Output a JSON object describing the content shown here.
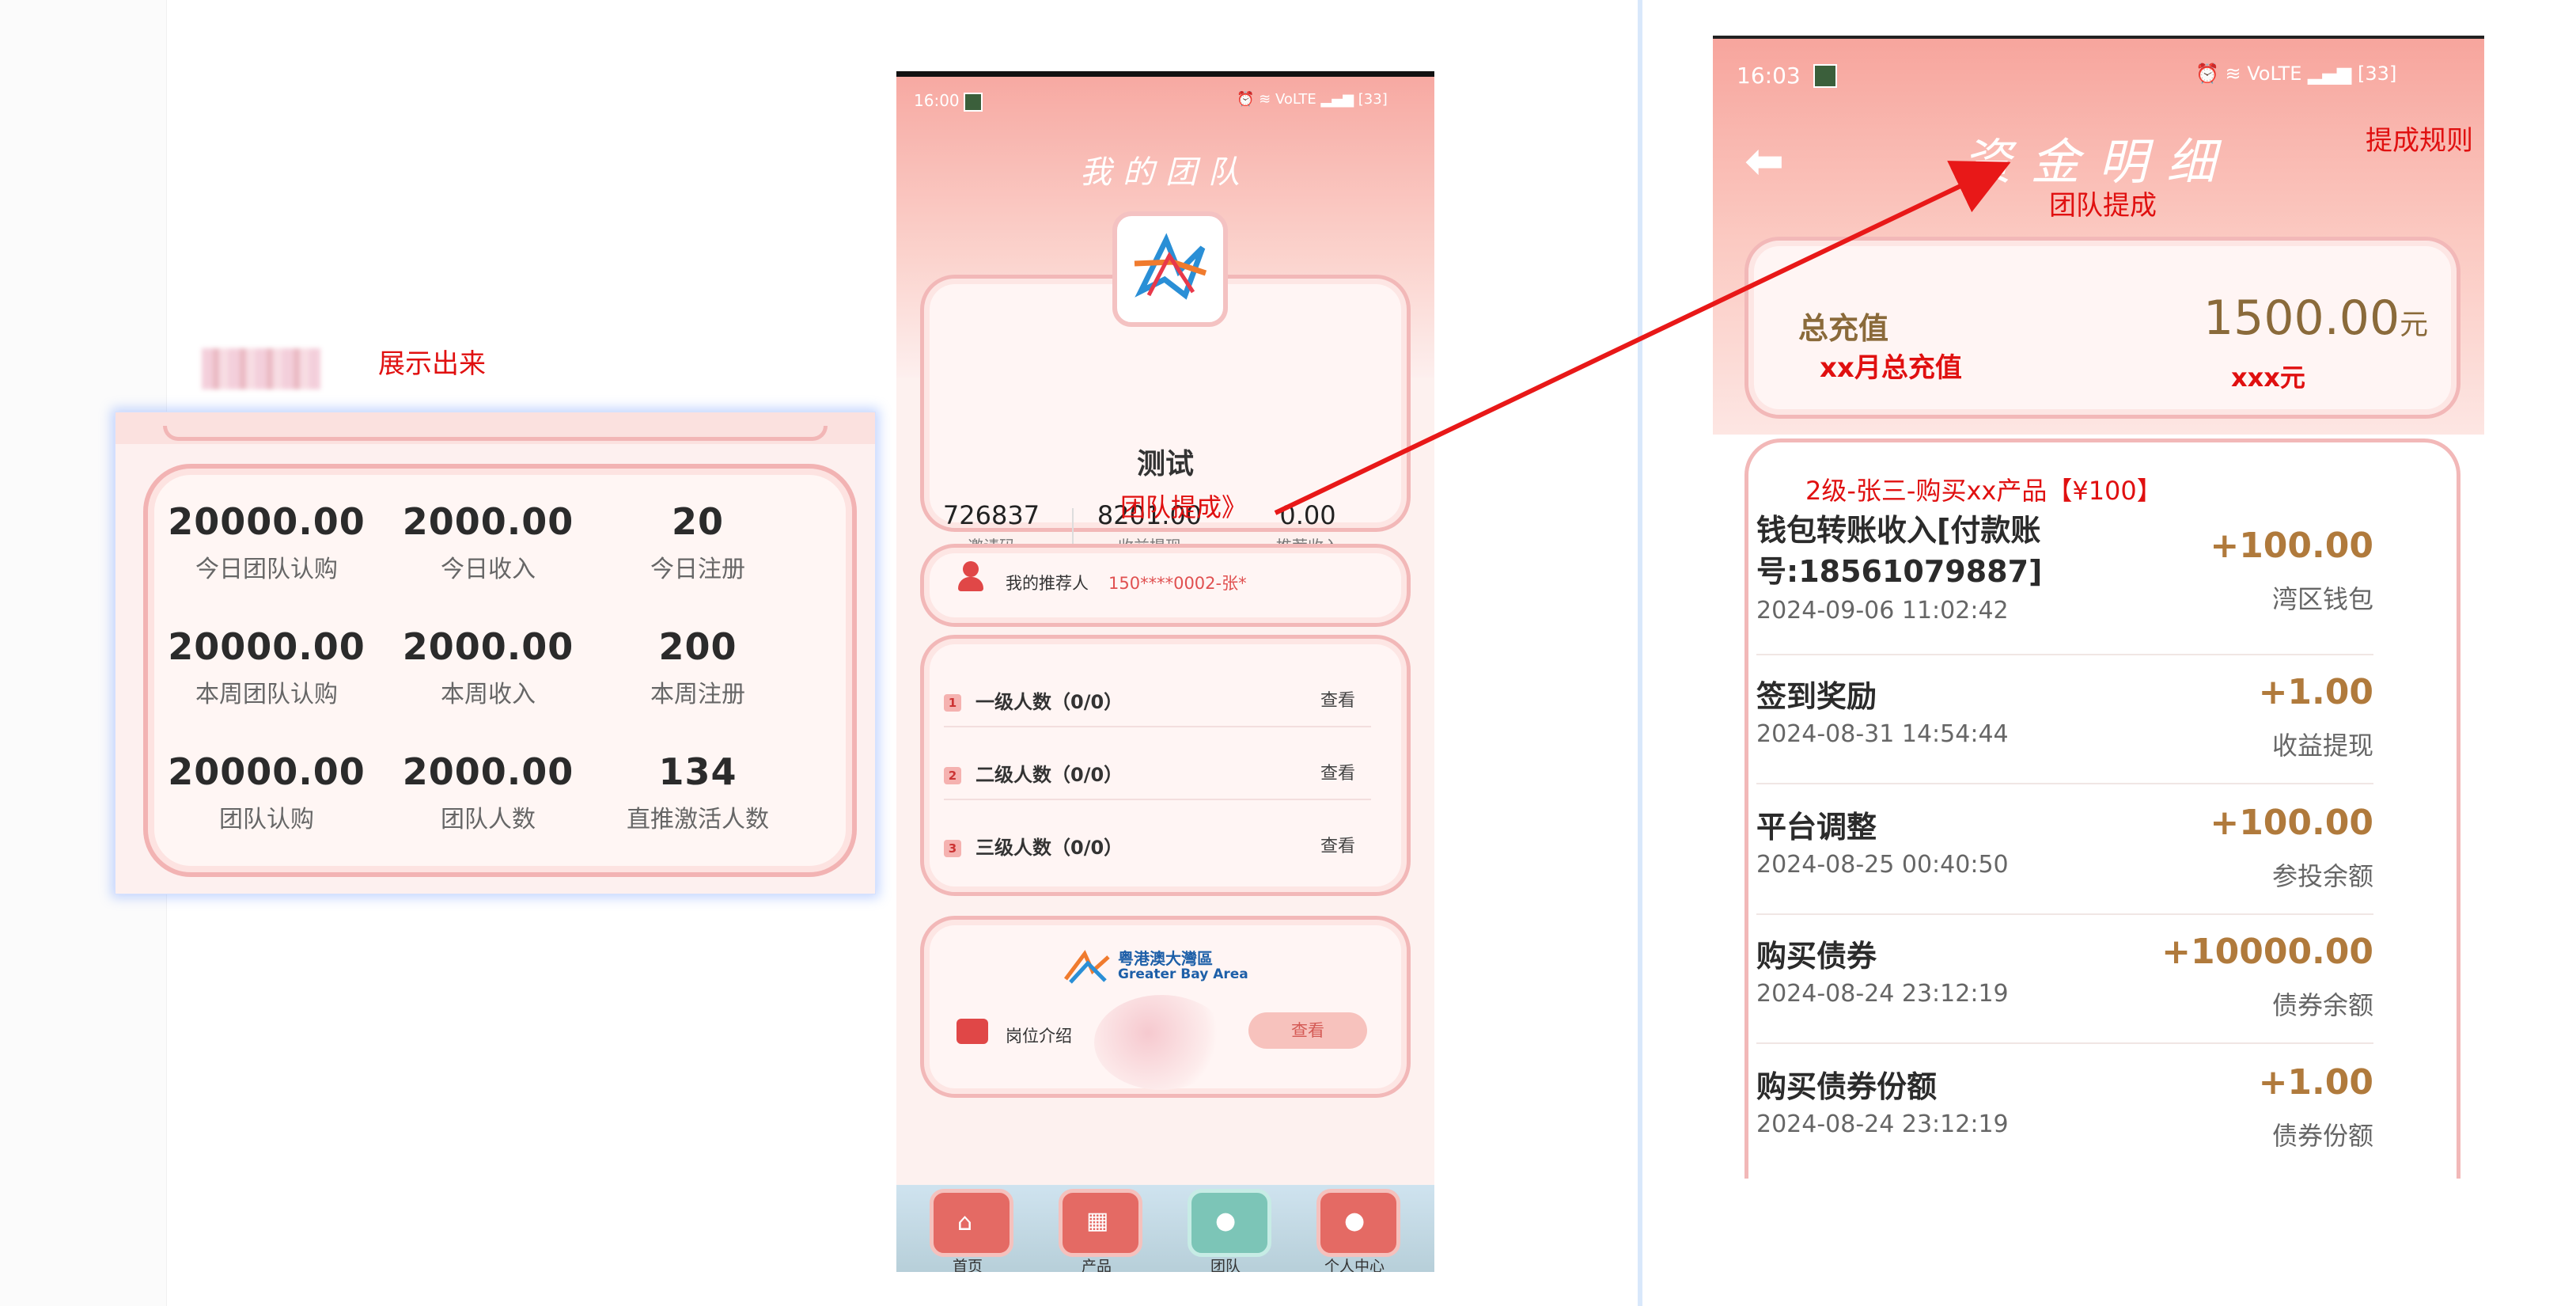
{
  "annotations": {
    "show_out": "展示出来",
    "team_commission_arrow_label": "团队提成》",
    "team_commission_title": "团队提成",
    "commission_rules": "提成规则",
    "month_total_recharge": "xx月总充值",
    "xxx_yuan": "xxx元",
    "row_note": "2级-张三-购买xx产品【¥100】"
  },
  "stats": [
    {
      "value": "20000.00",
      "label": "今日团队认购"
    },
    {
      "value": "2000.00",
      "label": "今日收入"
    },
    {
      "value": "20",
      "label": "今日注册"
    },
    {
      "value": "20000.00",
      "label": "本周团队认购"
    },
    {
      "value": "2000.00",
      "label": "本周收入"
    },
    {
      "value": "200",
      "label": "本周注册"
    },
    {
      "value": "20000.00",
      "label": "团队认购"
    },
    {
      "value": "2000.00",
      "label": "团队人数"
    },
    {
      "value": "134",
      "label": "直推激活人数"
    }
  ],
  "team_phone": {
    "time": "16:00",
    "status_right": "VoLTE",
    "battery": "33",
    "title": "我的团队",
    "user_name": "测试",
    "stats": [
      {
        "value": "726837",
        "label": "邀请码"
      },
      {
        "value": "8201.00",
        "label": "收益提现"
      },
      {
        "value": "0.00",
        "label": "推荐收入"
      }
    ],
    "referrer_label": "我的推荐人",
    "referrer_value": "150****0002-张*",
    "levels": [
      {
        "badge": "1",
        "label": "一级人数（0/0）",
        "action": "查看"
      },
      {
        "badge": "2",
        "label": "二级人数（0/0）",
        "action": "查看"
      },
      {
        "badge": "3",
        "label": "三级人数（0/0）",
        "action": "查看"
      }
    ],
    "gba_cn": "粤港澳大灣區",
    "gba_en": "Greater Bay Area",
    "job_intro": "岗位介绍",
    "job_view": "查看",
    "nav": [
      {
        "label": "首页",
        "icon": "home-icon"
      },
      {
        "label": "产品",
        "icon": "grid-icon"
      },
      {
        "label": "团队",
        "icon": "team-icon"
      },
      {
        "label": "个人中心",
        "icon": "user-icon"
      }
    ]
  },
  "funds_phone": {
    "time": "16:03",
    "status_right": "VoLTE",
    "battery": "33",
    "title": "资金明细",
    "total_label": "总充值",
    "total_value": "1500.00",
    "total_unit": "元",
    "records": [
      {
        "title": "钱包转账收入[付款账号:18561079887]",
        "amount": "+100.00",
        "date": "2024-09-06 11:02:42",
        "source": "湾区钱包"
      },
      {
        "title": "签到奖励",
        "amount": "+1.00",
        "date": "2024-08-31 14:54:44",
        "source": "收益提现"
      },
      {
        "title": "平台调整",
        "amount": "+100.00",
        "date": "2024-08-25 00:40:50",
        "source": "参投余额"
      },
      {
        "title": "购买债券",
        "amount": "+10000.00",
        "date": "2024-08-24 23:12:19",
        "source": "债券余额"
      },
      {
        "title": "购买债券份额",
        "amount": "+1.00",
        "date": "2024-08-24 23:12:19",
        "source": "债券份额"
      }
    ]
  },
  "colors": {
    "accent_red": "#e01010",
    "gold": "#b07a3c",
    "pink_border": "#f2b3b3"
  }
}
